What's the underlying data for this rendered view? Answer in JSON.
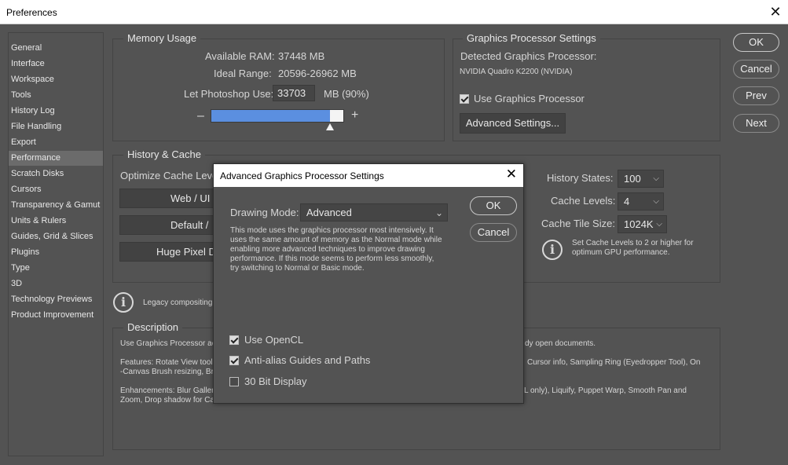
{
  "window": {
    "title": "Preferences"
  },
  "sidebar": {
    "items": [
      {
        "label": "General"
      },
      {
        "label": "Interface"
      },
      {
        "label": "Workspace"
      },
      {
        "label": "Tools"
      },
      {
        "label": "History Log"
      },
      {
        "label": "File Handling"
      },
      {
        "label": "Export"
      },
      {
        "label": "Performance",
        "selected": true
      },
      {
        "label": "Scratch Disks"
      },
      {
        "label": "Cursors"
      },
      {
        "label": "Transparency & Gamut"
      },
      {
        "label": "Units & Rulers"
      },
      {
        "label": "Guides, Grid & Slices"
      },
      {
        "label": "Plugins"
      },
      {
        "label": "Type"
      },
      {
        "label": "3D"
      },
      {
        "label": "Technology Previews"
      },
      {
        "label": "Product Improvement"
      }
    ]
  },
  "buttons": {
    "ok": "OK",
    "cancel": "Cancel",
    "prev": "Prev",
    "next": "Next"
  },
  "memory": {
    "title": "Memory Usage",
    "available_label": "Available RAM:",
    "available_value": "37448 MB",
    "ideal_label": "Ideal Range:",
    "ideal_value": "20596-26962 MB",
    "let_label": "Let Photoshop Use:",
    "let_value": "33703",
    "let_suffix": "MB (90%)",
    "minus": "–",
    "plus": "+",
    "slider_percent": 90
  },
  "gpu": {
    "title": "Graphics Processor Settings",
    "detected_label": "Detected Graphics Processor:",
    "detected_value": "NVIDIA Quadro K2200 (NVIDIA)",
    "use_label": "Use Graphics Processor",
    "use_checked": true,
    "advanced_button": "Advanced Settings..."
  },
  "history": {
    "title": "History & Cache",
    "optimize_label": "Optimize Cache Levels",
    "btn_web": "Web / UI",
    "btn_default": "Default /",
    "btn_huge": "Huge Pixel D",
    "states_label": "History States:",
    "states_value": "100",
    "levels_label": "Cache Levels:",
    "levels_value": "4",
    "tile_label": "Cache Tile Size:",
    "tile_value": "1024K",
    "tip": "Set Cache Levels to 2 or higher for optimum GPU performance.",
    "chevron": "⌵"
  },
  "legacy": {
    "text": "Legacy compositing"
  },
  "description": {
    "title": "Description",
    "line1_left": "Use Graphics Processor ac",
    "line1_right": "dy open documents.",
    "line2_left": "Features: Rotate View tool,",
    "line2_right": "Cursor info, Sampling Ring (Eyedropper Tool), On",
    "line3_left": "-Canvas Brush resizing, Br",
    "line4_left": "Enhancements: Blur Galler",
    "line4_right": "L only), Liquify, Puppet Warp, Smooth Pan and",
    "line5_left": "Zoom, Drop shadow for Ca"
  },
  "dialog": {
    "title": "Advanced Graphics Processor Settings",
    "close": "✕",
    "drawing_mode_label": "Drawing Mode:",
    "drawing_mode_value": "Advanced",
    "description": "This mode uses the graphics processor most intensively.  It uses the same amount of memory as the Normal mode while enabling more advanced techniques to improve drawing performance.  If this mode seems to perform less smoothly, try switching to Normal or Basic mode.",
    "ok": "OK",
    "cancel": "Cancel",
    "opencl_label": "Use OpenCL",
    "opencl_checked": true,
    "antialias_label": "Anti-alias Guides and Paths",
    "antialias_checked": true,
    "bit30_label": "30 Bit Display",
    "bit30_checked": false
  }
}
